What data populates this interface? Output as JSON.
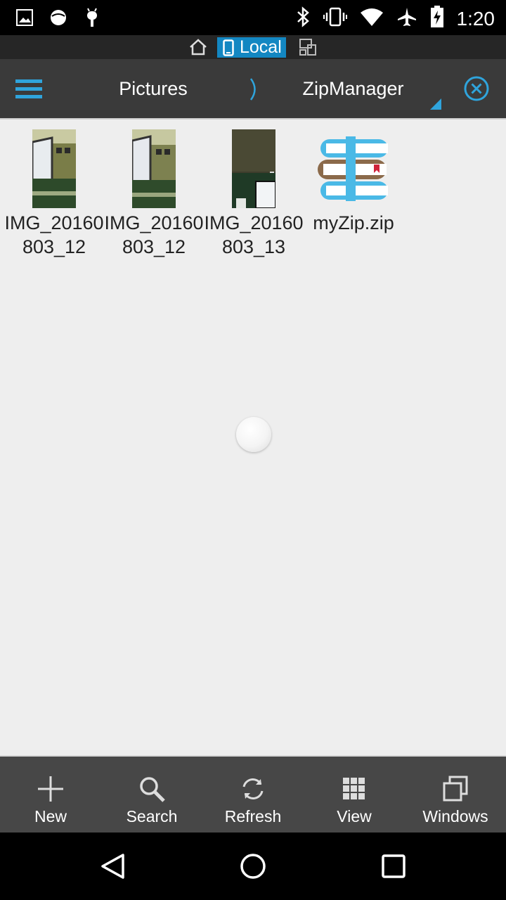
{
  "status_bar": {
    "time": "1:20",
    "left_icons": [
      "image-icon",
      "circle-app-icon",
      "android-debug-icon"
    ],
    "right_icons": [
      "bluetooth-icon",
      "vibrate-icon",
      "wifi-icon",
      "airplane-mode-icon",
      "battery-charging-icon"
    ]
  },
  "location": {
    "home_icon": "home-icon",
    "local_label": "Local",
    "network_icon": "network-icon"
  },
  "header": {
    "crumbs": [
      "Pictures",
      "ZipManager"
    ],
    "menu_icon": "hamburger-menu-icon",
    "close_icon": "close-circle-icon"
  },
  "files": [
    {
      "name": "IMG_20160803_12",
      "type": "image"
    },
    {
      "name": "IMG_20160803_12",
      "type": "image"
    },
    {
      "name": "IMG_20160803_13",
      "type": "image"
    },
    {
      "name": "myZip.zip",
      "type": "zip"
    }
  ],
  "toolbar": {
    "new_label": "New",
    "search_label": "Search",
    "refresh_label": "Refresh",
    "view_label": "View",
    "windows_label": "Windows"
  },
  "colors": {
    "accent": "#1387c2",
    "header_bg": "#3a3a3a",
    "toolbar_bg": "#474747",
    "content_bg": "#eeeeee"
  }
}
